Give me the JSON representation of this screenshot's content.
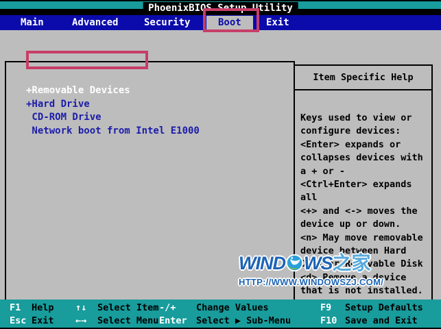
{
  "title": "PhoenixBIOS Setup Utility",
  "menu": {
    "items": [
      {
        "label": "Main",
        "selected": false
      },
      {
        "label": "Advanced",
        "selected": false
      },
      {
        "label": "Security",
        "selected": false
      },
      {
        "label": "Boot",
        "selected": true
      },
      {
        "label": "Exit",
        "selected": false
      }
    ]
  },
  "boot_list": {
    "items": [
      {
        "label": "+Removable Devices",
        "selected": true
      },
      {
        "label": "+Hard Drive",
        "selected": false
      },
      {
        "label": " CD-ROM Drive",
        "selected": false
      },
      {
        "label": " Network boot from Intel E1000",
        "selected": false
      }
    ]
  },
  "help_panel": {
    "title": "Item Specific Help",
    "lines": [
      "Keys used to view or",
      "configure devices:",
      "<Enter> expands or",
      "collapses devices with",
      "a + or -",
      "<Ctrl+Enter> expands",
      "all",
      "<+> and <-> moves the",
      "device up or down.",
      "<n> May move removable",
      "device between Hard",
      "Disk or Removable Disk",
      "<d> Remove a device",
      "that is not installed."
    ]
  },
  "footer": {
    "rows": [
      [
        {
          "key": "F1",
          "desc": "Help"
        },
        {
          "key": "↑↓",
          "desc": "Select Item"
        },
        {
          "key": "-/+",
          "desc": "Change Values"
        },
        {
          "key": "F9",
          "desc": "Setup Defaults"
        }
      ],
      [
        {
          "key": "Esc",
          "desc": "Exit"
        },
        {
          "key": "←→",
          "desc": "Select Menu"
        },
        {
          "key": "Enter",
          "desc": "Select ▶ Sub-Menu"
        },
        {
          "key": "F10",
          "desc": "Save and Exit"
        }
      ]
    ]
  },
  "watermark": {
    "brand_prefix": "WIND",
    "brand_suffix": "WS",
    "brand_cn": "之家",
    "url": "HTTP://WWW.WINDOWSZJ.COM/"
  },
  "colors": {
    "menu_blue": "#0b0bab",
    "teal": "#189c9c",
    "content_gray": "#bdbdbd",
    "item_text_blue": "#1c1caa",
    "annotation_pink": "#c73e68",
    "watermark_blue": "#1d64b5",
    "watermark_light_blue": "#58aadc"
  }
}
